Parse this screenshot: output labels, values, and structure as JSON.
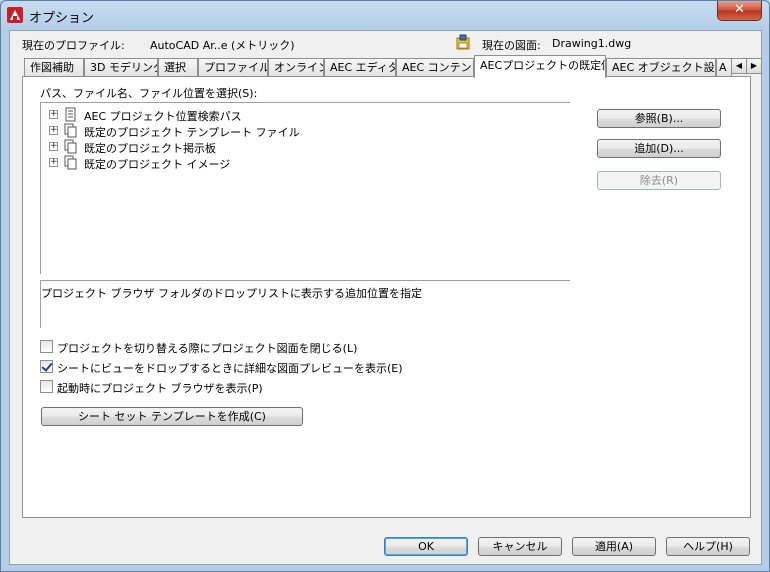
{
  "window": {
    "title": "オプション",
    "close_label": "✕"
  },
  "profile": {
    "label": "現在のプロファイル:",
    "value": "AutoCAD Ar..e (メトリック)"
  },
  "drawing": {
    "label": "現在の図面:",
    "value": "Drawing1.dwg"
  },
  "tabs": [
    {
      "label": "作図補助"
    },
    {
      "label": "3D モデリング"
    },
    {
      "label": "選択"
    },
    {
      "label": "プロファイル"
    },
    {
      "label": "オンライン"
    },
    {
      "label": "AEC エディタ"
    },
    {
      "label": "AEC コンテンツ"
    },
    {
      "label": "AECプロジェクトの既定値"
    },
    {
      "label": "AEC オブジェクト設定"
    },
    {
      "label": "A"
    }
  ],
  "tab_scroll": {
    "left": "◀",
    "right": "▶"
  },
  "panel": {
    "tree_label": "パス、ファイル名、ファイル位置を選択(S):",
    "tree_items": [
      {
        "expander": "+",
        "label": "AEC プロジェクト位置検索パス"
      },
      {
        "expander": "+",
        "label": "既定のプロジェクト テンプレート ファイル"
      },
      {
        "expander": "+",
        "label": "既定のプロジェクト掲示板"
      },
      {
        "expander": "+",
        "label": "既定のプロジェクト イメージ"
      }
    ],
    "description": "プロジェクト ブラウザ フォルダのドロップリストに表示する追加位置を指定",
    "browse_button": "参照(B)...",
    "add_button": "追加(D)...",
    "remove_button": "除去(R)",
    "checkboxes": [
      {
        "label": "プロジェクトを切り替える際にプロジェクト図面を閉じる(L)",
        "checked": false
      },
      {
        "label": "シートにビューをドロップするときに詳細な図面プレビューを表示(E)",
        "checked": true
      },
      {
        "label": "起動時にプロジェクト ブラウザを表示(P)",
        "checked": false
      }
    ],
    "sheet_template_button": "シート セット テンプレートを作成(C)"
  },
  "footer": {
    "ok": "OK",
    "cancel": "キャンセル",
    "apply": "適用(A)",
    "help": "ヘルプ(H)"
  }
}
